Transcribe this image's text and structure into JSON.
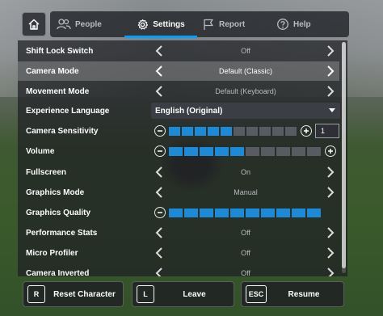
{
  "topbar": {
    "tabs": [
      {
        "label": "People",
        "icon": "people-icon"
      },
      {
        "label": "Settings",
        "icon": "gear-icon"
      },
      {
        "label": "Report",
        "icon": "flag-icon"
      },
      {
        "label": "Help",
        "icon": "help-icon"
      }
    ],
    "active_tab": "Settings"
  },
  "settings": [
    {
      "label": "Shift Lock Switch",
      "type": "selector",
      "value": "Off"
    },
    {
      "label": "Camera Mode",
      "type": "selector",
      "value": "Default (Classic)",
      "highlighted": true
    },
    {
      "label": "Movement Mode",
      "type": "selector",
      "value": "Default (Keyboard)"
    },
    {
      "label": "Experience Language",
      "type": "dropdown",
      "value": "English (Original)"
    },
    {
      "label": "Camera Sensitivity",
      "type": "slider",
      "level": 5,
      "segments": 10,
      "input_value": "1"
    },
    {
      "label": "Volume",
      "type": "slider",
      "level": 5,
      "segments": 10
    },
    {
      "label": "Fullscreen",
      "type": "selector",
      "value": "On"
    },
    {
      "label": "Graphics Mode",
      "type": "selector",
      "value": "Manual"
    },
    {
      "label": "Graphics Quality",
      "type": "slider",
      "level": 10,
      "segments": 10
    },
    {
      "label": "Performance Stats",
      "type": "selector",
      "value": "Off"
    },
    {
      "label": "Micro Profiler",
      "type": "selector",
      "value": "Off"
    },
    {
      "label": "Camera Inverted",
      "type": "selector",
      "value": "Off"
    }
  ],
  "bottom_buttons": [
    {
      "key": "R",
      "label": "Reset Character"
    },
    {
      "key": "L",
      "label": "Leave"
    },
    {
      "key": "ESC",
      "label": "Resume"
    }
  ],
  "colors": {
    "accent": "#00a2ff",
    "slider_on": "#1c8ad6",
    "slider_off": "#585c62",
    "highlight": "#969696"
  }
}
